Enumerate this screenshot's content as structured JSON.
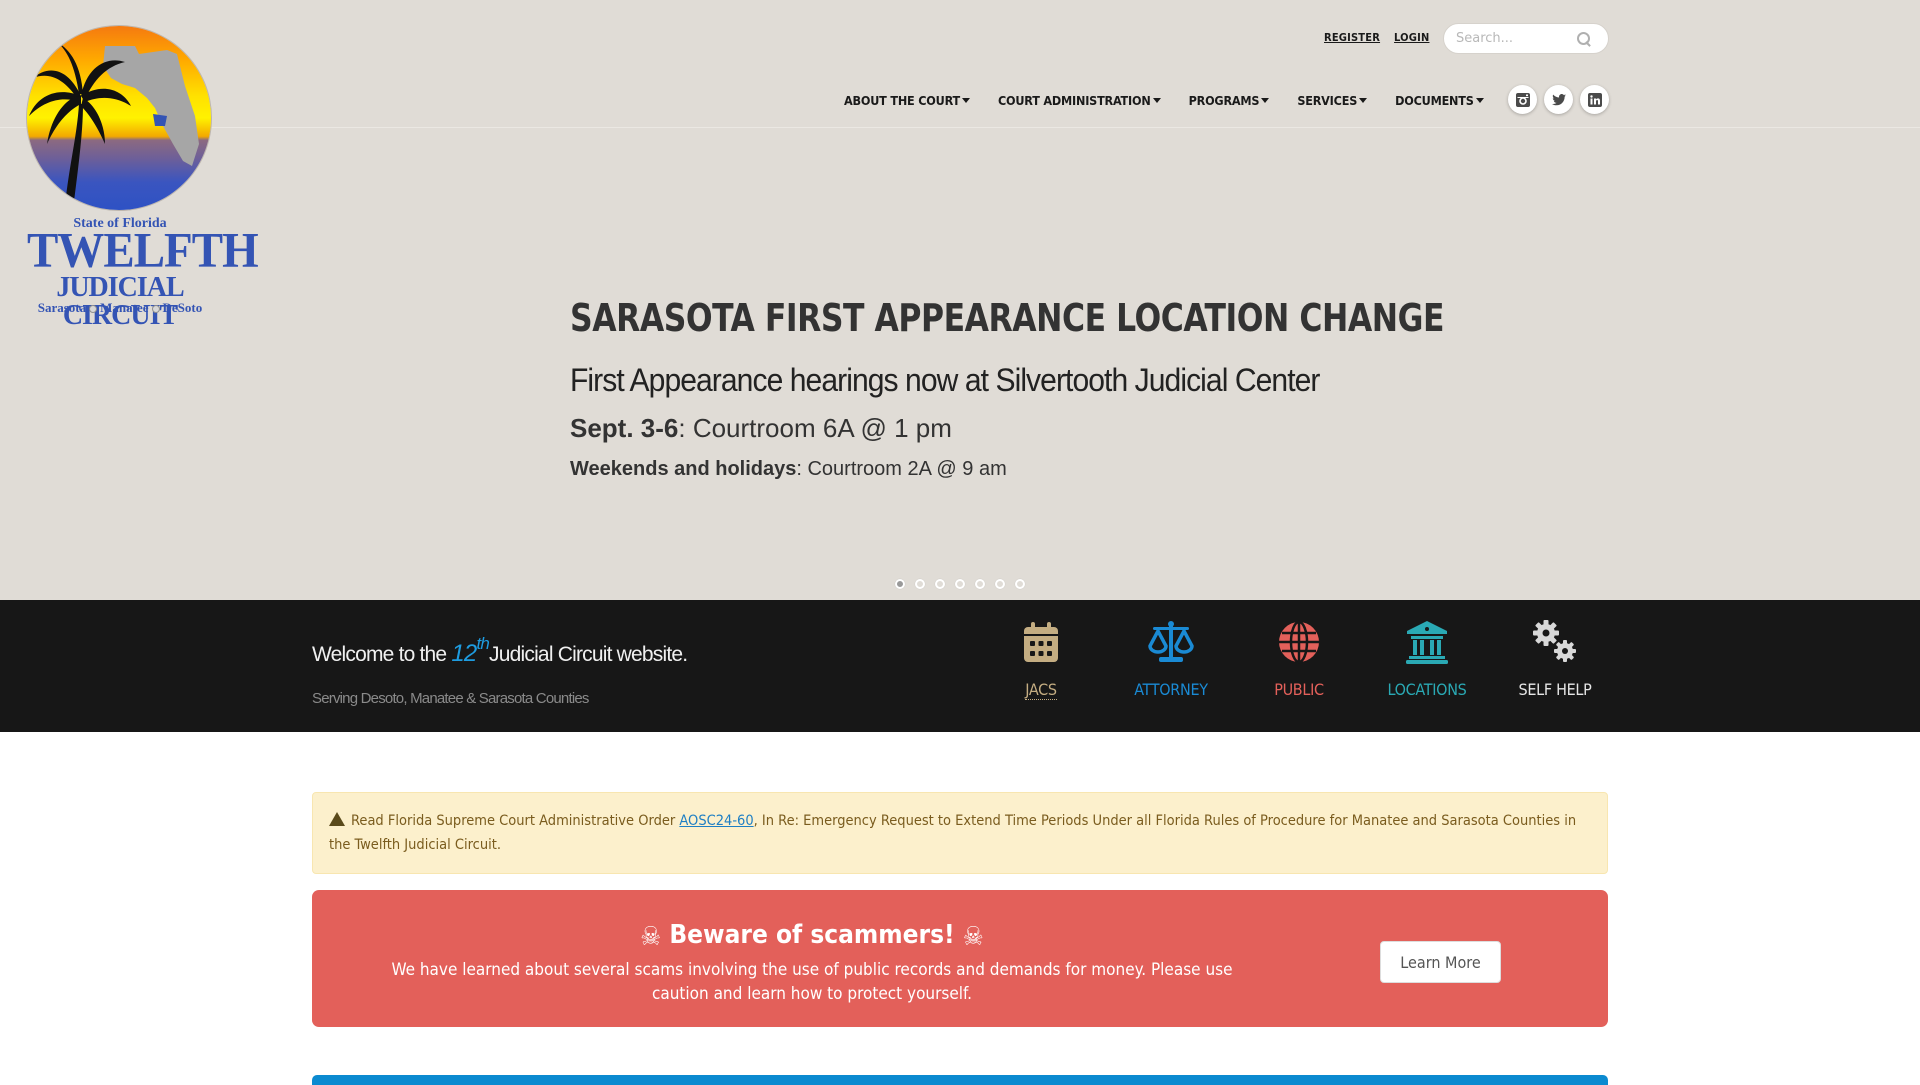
{
  "logo": {
    "state": "State of Florida",
    "title": "TWELFTH",
    "subtitle": "JUDICIAL CIRCUIT",
    "counties": [
      "Sarasota",
      "Manatee",
      "DeSoto"
    ]
  },
  "header": {
    "register_label": "REGISTER",
    "login_label": "LOGIN",
    "search_placeholder": "Search...",
    "nav": [
      {
        "label": "ABOUT THE COURT"
      },
      {
        "label": "COURT ADMINISTRATION"
      },
      {
        "label": "PROGRAMS"
      },
      {
        "label": "SERVICES"
      },
      {
        "label": "DOCUMENTS"
      }
    ],
    "social": [
      {
        "name": "instagram-icon",
        "glyph": "◙"
      },
      {
        "name": "twitter-icon",
        "glyph": "🐦"
      },
      {
        "name": "linkedin-icon",
        "glyph": "in"
      }
    ]
  },
  "slider": {
    "title": "SARASOTA FIRST APPEARANCE LOCATION CHANGE",
    "subtitle": "First Appearance hearings now at Silvertooth Judicial Center",
    "line1_bold": "Sept. 3-6",
    "line1_rest": ": Courtroom 6A @ 1 pm",
    "line2_bold": "Weekends and holidays",
    "line2_rest": ": Courtroom 2A @ 9 am",
    "slide_count": 7,
    "active_slide": 1
  },
  "welcome": {
    "prefix": "Welcome to the ",
    "number": "12",
    "suffix_sup": "th",
    "rest": "Judicial Circuit website.",
    "serving": "Serving Desoto, Manatee & Sarasota Counties"
  },
  "quick_links": [
    {
      "label": "JACS",
      "color": "#c4ad82",
      "icon": "calendar-icon"
    },
    {
      "label": "ATTORNEY",
      "color": "#1a8ad4",
      "icon": "scales-icon"
    },
    {
      "label": "PUBLIC",
      "color": "#e3605a",
      "icon": "globe-icon"
    },
    {
      "label": "LOCATIONS",
      "color": "#2aa9b4",
      "icon": "courthouse-icon"
    },
    {
      "label": "SELF HELP",
      "color": "#d8d8d8",
      "icon": "gears-icon"
    }
  ],
  "notice": {
    "prefix": "Read Florida Supreme Court Administrative Order ",
    "link": "AOSC24-60",
    "suffix": ", In Re: Emergency Request to Extend Time Periods Under all Florida Rules of Procedure for Manatee and Sarasota Counties in the Twelfth Judicial Circuit."
  },
  "scam": {
    "title": "Beware of scammers!",
    "skull": "☠",
    "body": "We have learned about several scams involving the use of public records and demands for money. Please use caution and learn how to protect yourself.",
    "button": "Learn More"
  }
}
